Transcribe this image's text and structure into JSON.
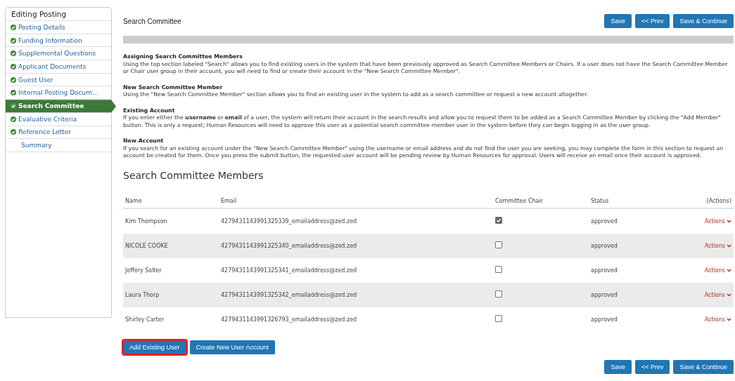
{
  "sidebar": {
    "title": "Editing Posting",
    "items": [
      {
        "label": "Posting Details",
        "complete": true,
        "selected": false
      },
      {
        "label": "Funding Information",
        "complete": true,
        "selected": false
      },
      {
        "label": "Supplemental Questions",
        "complete": true,
        "selected": false
      },
      {
        "label": "Applicant Documents",
        "complete": true,
        "selected": false
      },
      {
        "label": "Guest User",
        "complete": true,
        "selected": false
      },
      {
        "label": "Internal Posting Docum...",
        "complete": true,
        "selected": false
      },
      {
        "label": "Search Committee",
        "complete": true,
        "selected": true
      },
      {
        "label": "Evaluative Criteria",
        "complete": true,
        "selected": false
      },
      {
        "label": "Reference Letter",
        "complete": true,
        "selected": false
      },
      {
        "label": "Summary",
        "complete": false,
        "selected": false
      }
    ]
  },
  "page_title": "Search Committee",
  "top_buttons": [
    "Save",
    "<< Prev",
    "Save & Continue"
  ],
  "sections": [
    {
      "heading": "Assigning Search Committee Members",
      "text": "Using the top section labeled \"Search\" allows you to find existing users in the system that have been previously approved as Search Committee Members or Chairs. If a user does not have the Search Committee Member or Chair user group in their account, you will need to find or create their account in the \"New Search Committee Member\"."
    },
    {
      "heading": "New Search Committee Member",
      "text": "Using the \"New Search Committee Member\" section allows you to find an existing user in the system to add as a search committee or request a new account altogether."
    },
    {
      "heading": "Existing Account",
      "text": "If you enter either the **username** or **email** of a user, the system will return their account in the search results and allow you to request them to be added as a Search Committee Member by clicking the \"Add Member\" button. This is only a request; Human Resources will need to approve this user as a potential search committee member user in the system before they can begin logging in as the user group."
    },
    {
      "heading": "New Account",
      "text": "If you search for an existing account under the \"New Search Committee Member\" using the username or email address and do not find the user you are seeking, you may complete the form in this section to request an account be created for them. Once you press the submit button, the requested user account will be pending review by Human Resources for approval. Users will receive an email once their account is approved."
    }
  ],
  "members": {
    "title": "Search Committee Members",
    "columns": [
      "Name",
      "Email",
      "Committee Chair",
      "Status",
      "(Actions)"
    ],
    "rows": [
      {
        "name": "Kim Thompson",
        "email": "4279431143991325339_emailaddress@zed.zed",
        "chair": true,
        "status": "approved",
        "action": "Actions"
      },
      {
        "name": "NICOLE COOKE",
        "email": "4279431143991325340_emailaddress@zed.zed",
        "chair": false,
        "status": "approved",
        "action": "Actions"
      },
      {
        "name": "Jeffery Salter",
        "email": "4279431143991325341_emailaddress@zed.zed",
        "chair": false,
        "status": "approved",
        "action": "Actions"
      },
      {
        "name": "Laura Thorp",
        "email": "4279431143991325342_emailaddress@zed.zed",
        "chair": false,
        "status": "approved",
        "action": "Actions"
      },
      {
        "name": "Shirley Carter",
        "email": "4279431143991326793_emailaddress@zed.zed",
        "chair": false,
        "status": "approved",
        "action": "Actions"
      }
    ]
  },
  "member_buttons": [
    {
      "label": "Add Existing User",
      "highlighted": true
    },
    {
      "label": "Create New User Account",
      "highlighted": false
    }
  ],
  "bottom_buttons": [
    "Save",
    "<< Prev",
    "Save & Continue"
  ]
}
